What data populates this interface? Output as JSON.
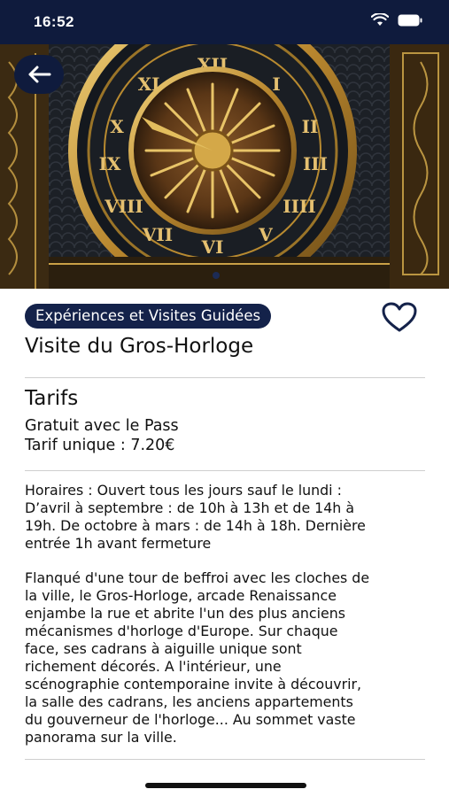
{
  "status": {
    "time": "16:52",
    "icons": [
      "signal-icon",
      "wifi-icon",
      "battery-icon"
    ]
  },
  "hero": {
    "image": "Gros-Horloge astronomical clock face",
    "pager_index": 1
  },
  "back_button": {
    "icon": "arrow-left-icon"
  },
  "category": "Expériences et Visites Guidées",
  "favorite": {
    "icon": "heart-outline-icon",
    "active": false
  },
  "title": "Visite du Gros-Horloge",
  "tarifs": {
    "heading": "Tarifs",
    "lines": [
      "Gratuit avec le Pass",
      "Tarif unique : 7.20€"
    ]
  },
  "horaires": [
    "Horaires :  Ouvert tous les jours sauf le lundi :",
    "D’avril à septembre : de 10h à 13h et de 14h à",
    "19h. De octobre à mars : de 14h à 18h. Dernière",
    "entrée 1h avant fermeture"
  ],
  "description": [
    "Flanqué d'une tour de beffroi avec les cloches de",
    "la ville, le Gros-Horloge, arcade Renaissance",
    "enjambe la rue et abrite l'un des plus anciens",
    "mécanismes d'horloge d'Europe. Sur chaque",
    "face, ses cadrans à aiguille unique sont",
    "richement décorés. A l'intérieur, une",
    "scénographie contemporaine invite à découvrir,",
    "la salle des cadrans, les anciens appartements",
    "du gouverneur de l'horloge... Au sommet vaste",
    "panorama sur la ville."
  ],
  "colors": {
    "navy": "#0f1b3d",
    "badge": "#14224a",
    "divider": "#cfcfcf"
  }
}
